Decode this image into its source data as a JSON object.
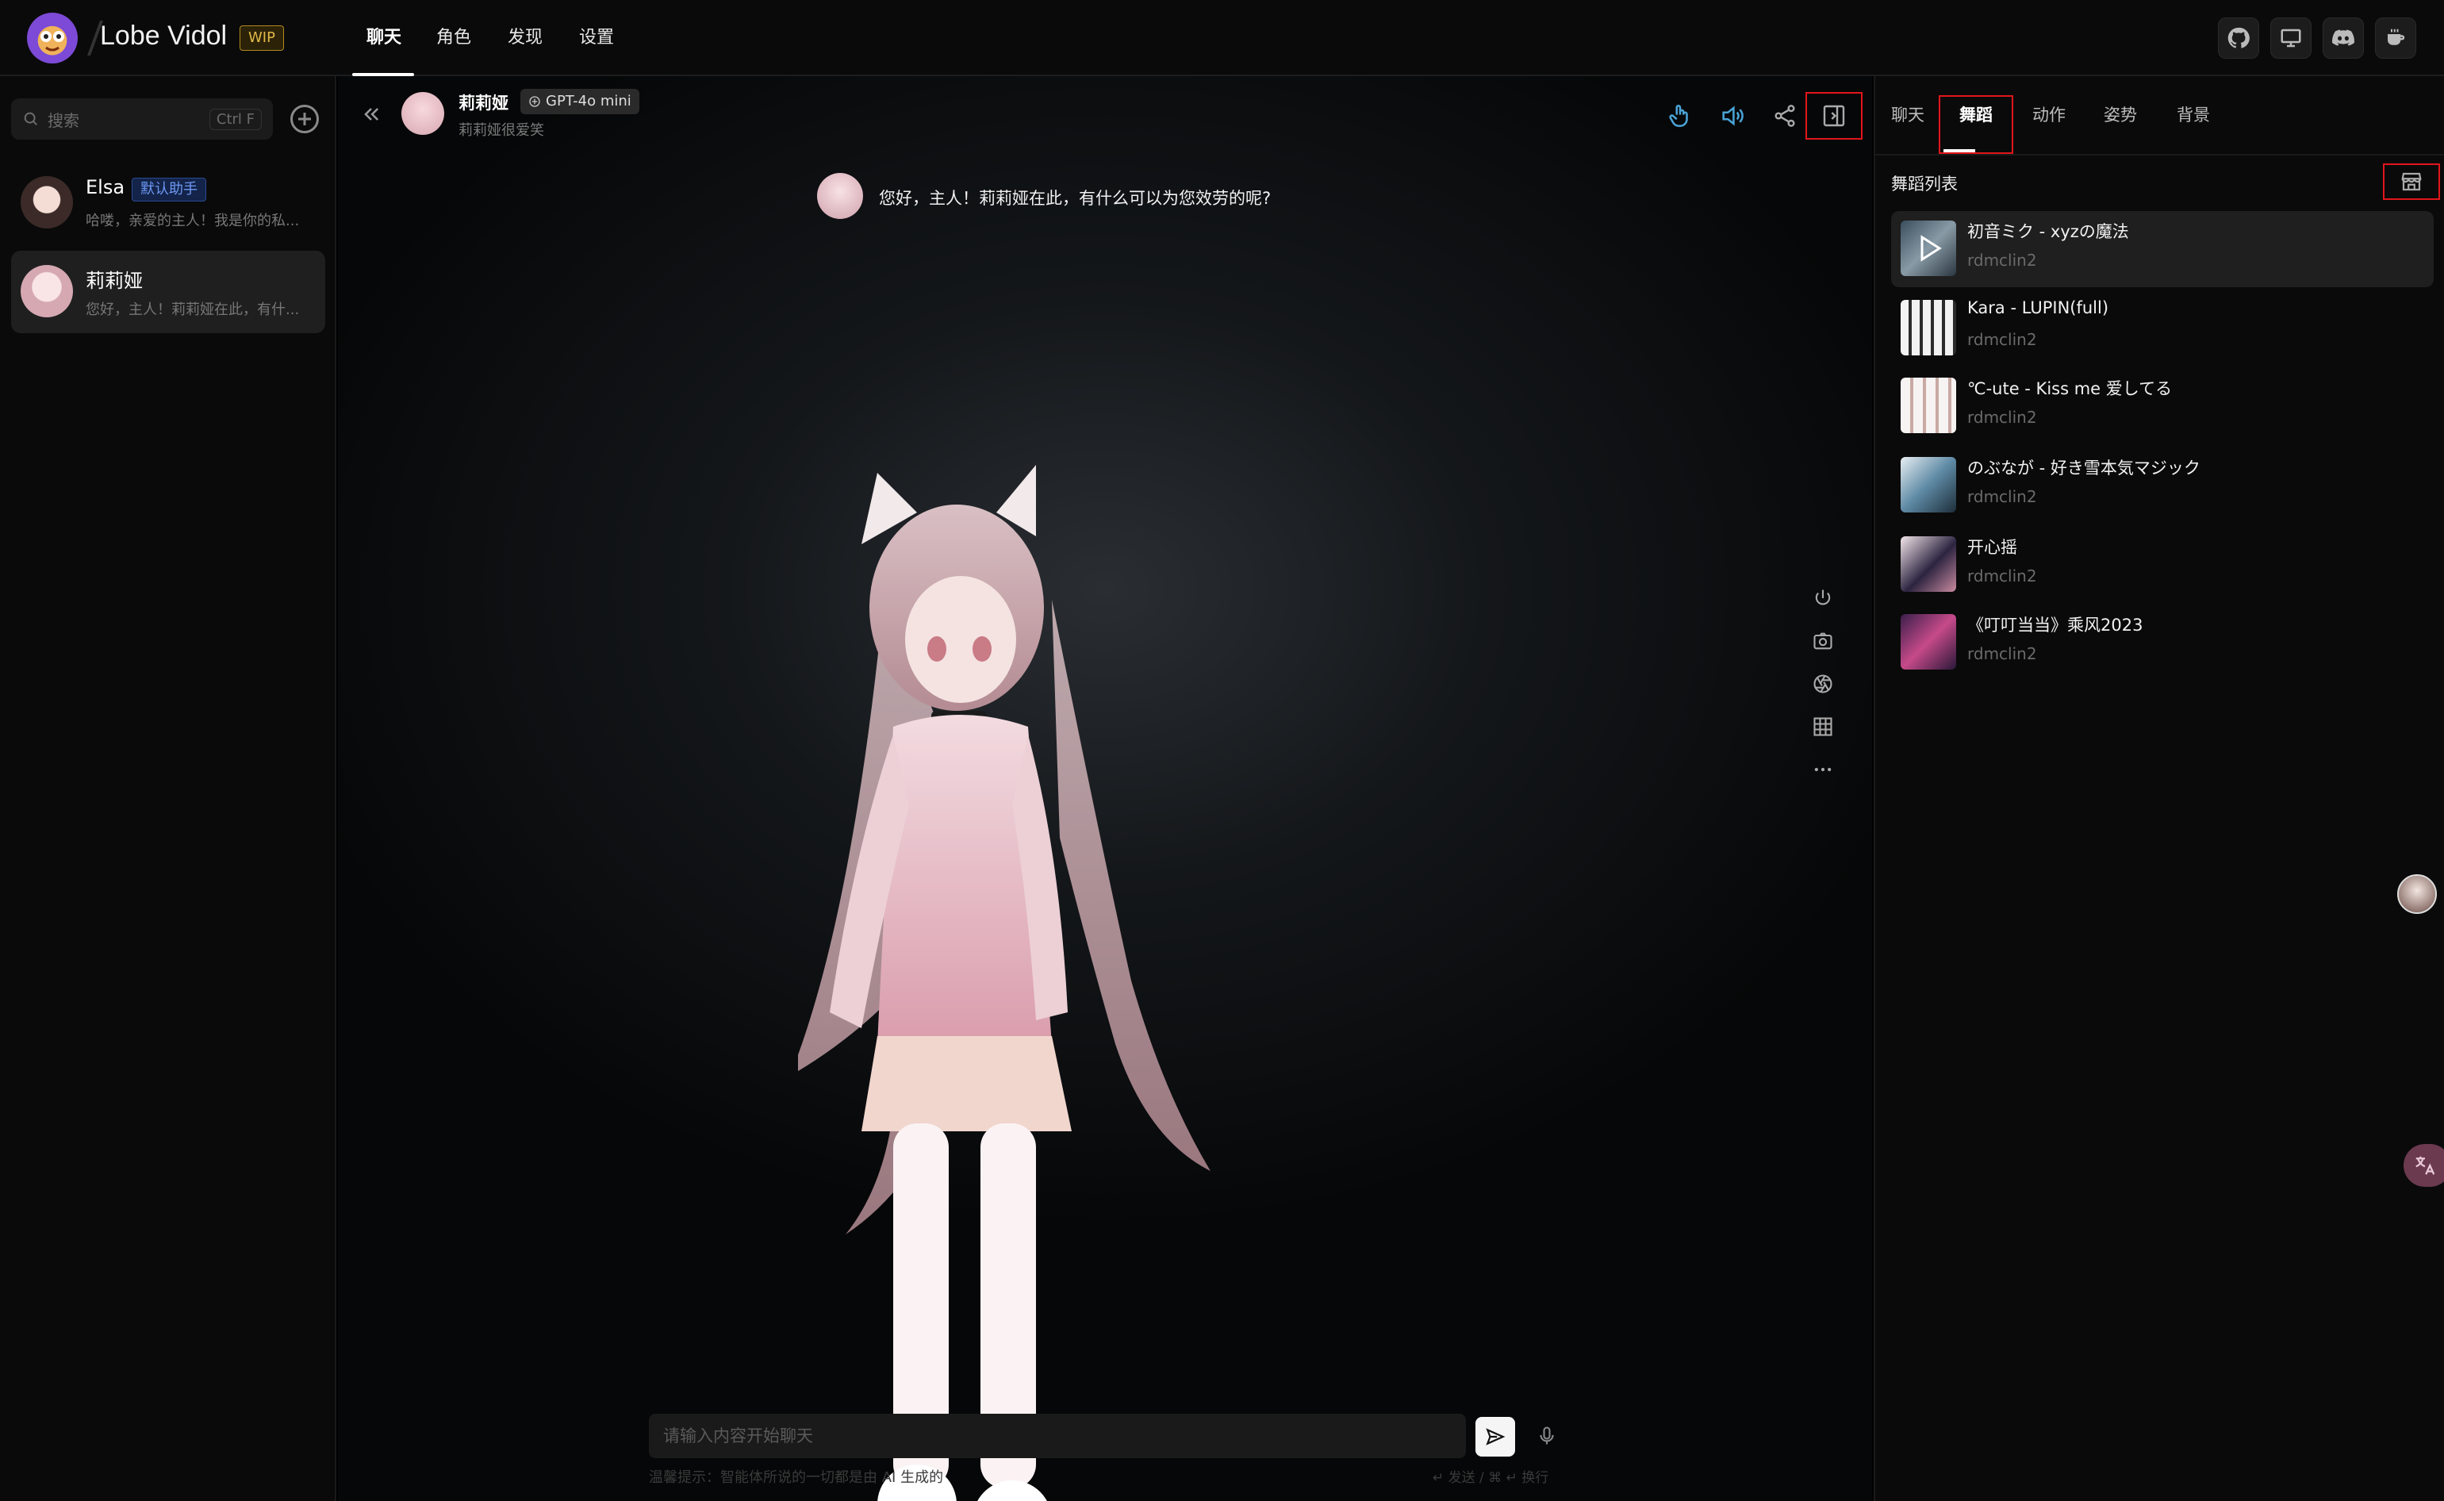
{
  "app": {
    "title": "Lobe Vidol",
    "badge": "WIP"
  },
  "nav": {
    "items": [
      "聊天",
      "角色",
      "发现",
      "设置"
    ],
    "active": 0
  },
  "sidebar": {
    "search_placeholder": "搜索",
    "search_shortcut": "Ctrl F",
    "sessions": [
      {
        "name": "Elsa",
        "tag": "默认助手",
        "desc": "哈喽，亲爱的主人！我是你的私..."
      },
      {
        "name": "莉莉娅",
        "desc": "您好，主人！莉莉娅在此，有什..."
      }
    ]
  },
  "chat": {
    "agent_name": "莉莉娅",
    "model": "GPT-4o mini",
    "agent_desc": "莉莉娅很爱笑",
    "greeting": "您好，主人！莉莉娅在此，有什么可以为您效劳的呢?",
    "input_placeholder": "请输入内容开始聊天",
    "hint_left": "温馨提示：智能体所说的一切都是由 AI 生成的",
    "hint_right": "↵ 发送 / ⌘ ↵ 换行"
  },
  "right_panel": {
    "tabs": [
      "聊天",
      "舞蹈",
      "动作",
      "姿势",
      "背景"
    ],
    "active_tab": 1,
    "list_title": "舞蹈列表",
    "dances": [
      {
        "title": "初音ミク - xyzの魔法",
        "author": "rdmclin2"
      },
      {
        "title": "Kara - LUPIN(full)",
        "author": "rdmclin2"
      },
      {
        "title": "℃-ute - Kiss me 爱してる",
        "author": "rdmclin2"
      },
      {
        "title": "のぶなが - 好き雪本気マジック",
        "author": "rdmclin2"
      },
      {
        "title": "开心摇",
        "author": "rdmclin2"
      },
      {
        "title": "《叮叮当当》乘风2023",
        "author": "rdmclin2"
      }
    ]
  },
  "colors": {
    "accent_highlight": "#e0161b",
    "tool_active": "#4aa3d6"
  }
}
